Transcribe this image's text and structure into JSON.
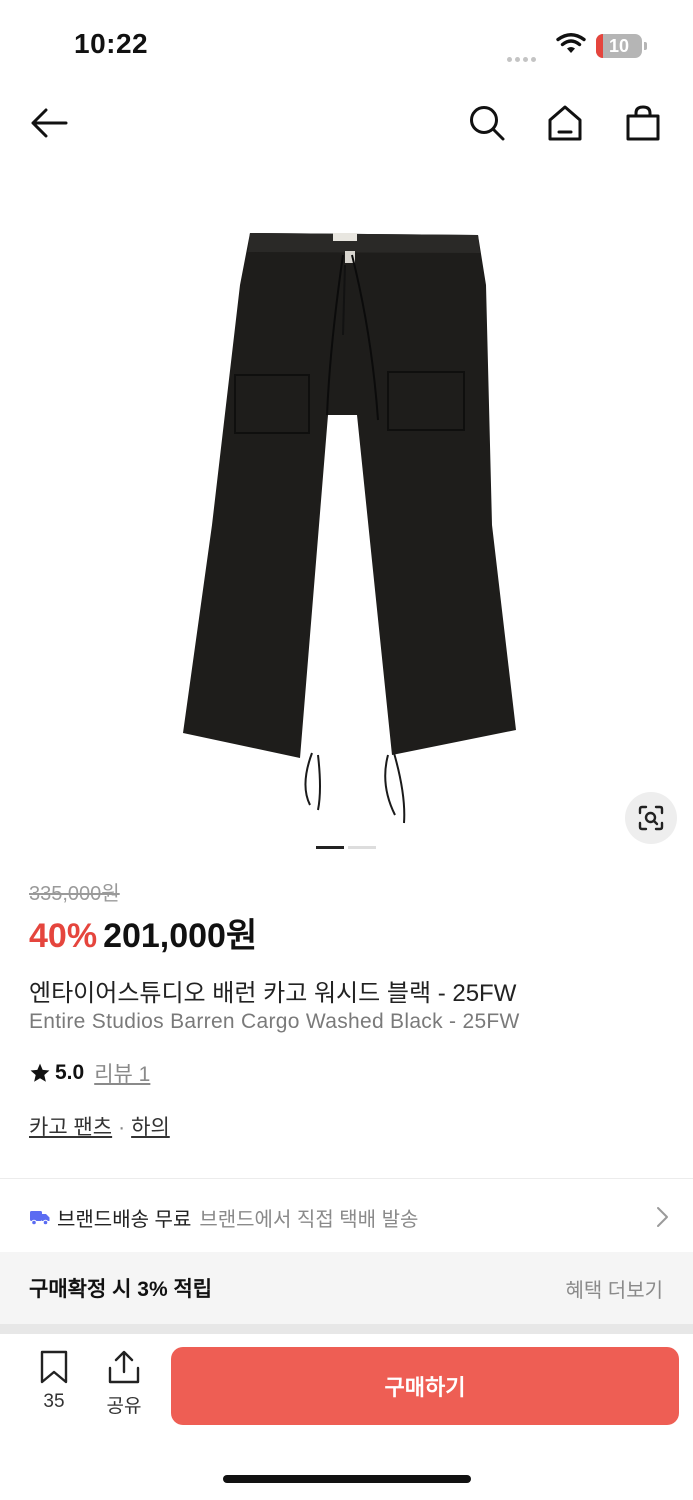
{
  "status_bar": {
    "time": "10:22",
    "battery": "10",
    "icons": [
      "signal-dots-icon",
      "wifi-icon",
      "battery-icon"
    ]
  },
  "nav": {
    "icons": [
      "back-arrow-icon",
      "search-icon",
      "home-icon",
      "shopping-bag-icon"
    ]
  },
  "gallery": {
    "image_subject": "black wide-leg cargo pants",
    "slide_count": 2,
    "active_slide": 1,
    "icons": [
      "lens-search-icon"
    ]
  },
  "product": {
    "original_price": "335,000원",
    "discount": "40%",
    "price": "201,000원",
    "name_ko": "엔타이어스튜디오 배런 카고 워시드 블랙 - 25FW",
    "name_en": "Entire Studios Barren Cargo Washed Black - 25FW",
    "rating": "5.0",
    "review_label": "리뷰 1",
    "category_1": "카고 팬츠",
    "category_separator": "·",
    "category_2": "하의"
  },
  "shipping": {
    "title": "브랜드배송 무료",
    "desc": "브랜드에서 직접 택배 발송"
  },
  "benefit": {
    "title": "구매확정 시 3% 적립",
    "more": "혜택 더보기"
  },
  "bottom_bar": {
    "bookmark_count": "35",
    "share_label": "공유",
    "buy_label": "구매하기"
  },
  "colors": {
    "accent": "#ee5e54",
    "discount": "#e5453d",
    "shipping_icon": "#5b6cf2"
  }
}
